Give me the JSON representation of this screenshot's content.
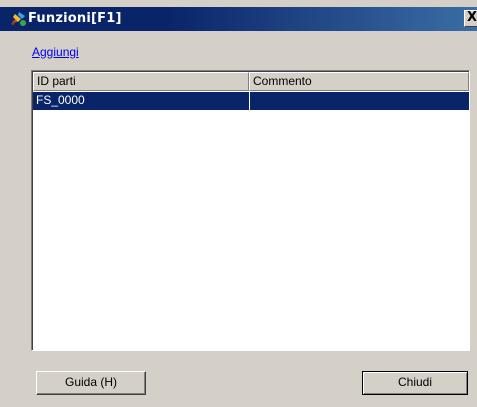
{
  "window": {
    "title": "Funzioni[F1]",
    "close_label": "X"
  },
  "add_link": "Aggiungi",
  "table": {
    "columns": [
      "ID parti",
      "Commento"
    ],
    "rows": [
      {
        "id": "FS_0000",
        "comment": "",
        "selected": true
      }
    ]
  },
  "buttons": {
    "help": "Guida (H)",
    "close": "Chiudi"
  },
  "colors": {
    "selection": "#0a246a",
    "titlebar": "#0a246a",
    "face": "#d4d0c8",
    "link": "#0000ee"
  },
  "icons": {
    "title": "functions-app-icon",
    "close": "close-icon"
  }
}
